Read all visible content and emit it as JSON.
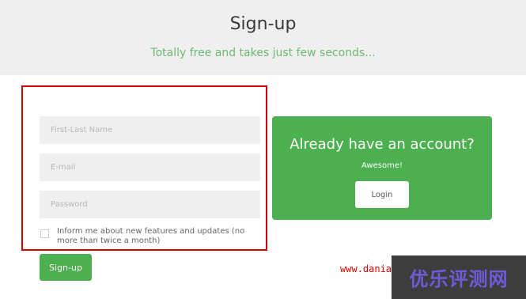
{
  "header": {
    "title": "Sign-up",
    "subtitle": "Totally free and takes just few seconds..."
  },
  "form": {
    "name_placeholder": "First-Last Name",
    "email_placeholder": "E-mail",
    "password_placeholder": "Password",
    "checkbox_label": "Inform me about new features and updates (no more than twice a month)",
    "checkbox_checked": false,
    "submit_label": "Sign-up"
  },
  "account_panel": {
    "title": "Already have an account?",
    "subtitle": "Awesome!",
    "login_label": "Login"
  },
  "watermark": {
    "url_text": "www.dania",
    "brand_text": "优乐评测网",
    "brand_bg_color": "#3d3d3d"
  },
  "colors": {
    "accent_green": "#4caf50",
    "subtitle_green": "#6dbb71",
    "highlight_red": "#d90000"
  }
}
